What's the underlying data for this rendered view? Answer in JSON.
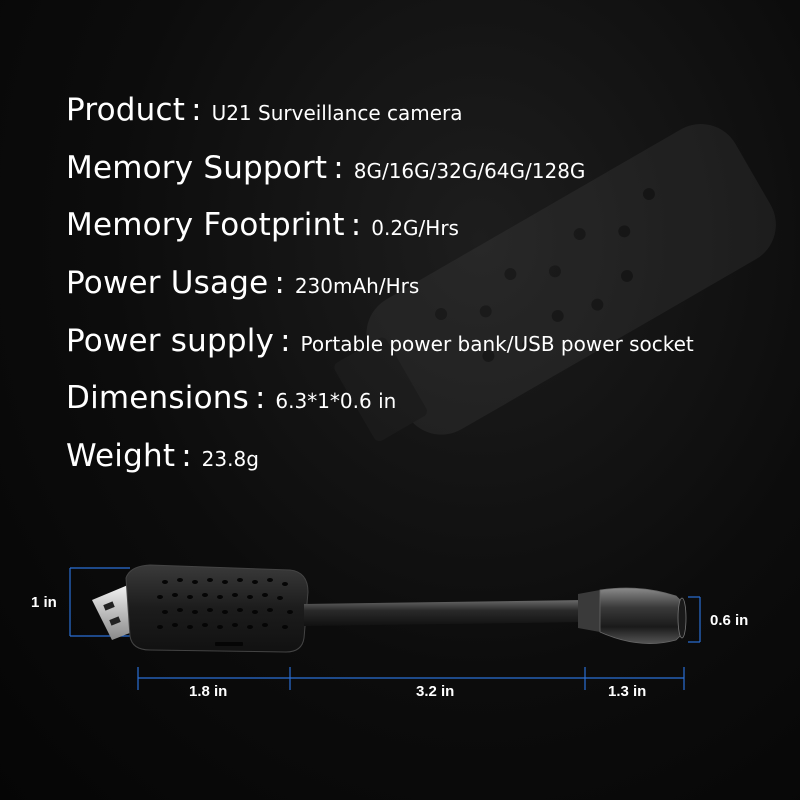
{
  "specs": [
    {
      "label": "Product",
      "sep": ":",
      "value": "U21 Surveillance camera"
    },
    {
      "label": "Memory Support",
      "sep": ":",
      "value": "8G/16G/32G/64G/128G"
    },
    {
      "label": "Memory Footprint",
      "sep": ":",
      "value": "0.2G/Hrs"
    },
    {
      "label": "Power Usage",
      "sep": ":",
      "value": "230mAh/Hrs"
    },
    {
      "label": "Power supply",
      "sep": ":",
      "value": "Portable power bank/USB power socket"
    },
    {
      "label": "Dimensions",
      "sep": ":",
      "value": "6.3*1*0.6 in"
    },
    {
      "label": "Weight",
      "sep": ":",
      "value": "23.8g"
    }
  ],
  "dimensions": {
    "height": "1 in",
    "lens_height": "0.6 in",
    "body_length": "1.8 in",
    "neck_length": "3.2 in",
    "lens_length": "1.3 in"
  },
  "colors": {
    "dimension_line": "#2a6fd6",
    "text": "#ffffff"
  }
}
